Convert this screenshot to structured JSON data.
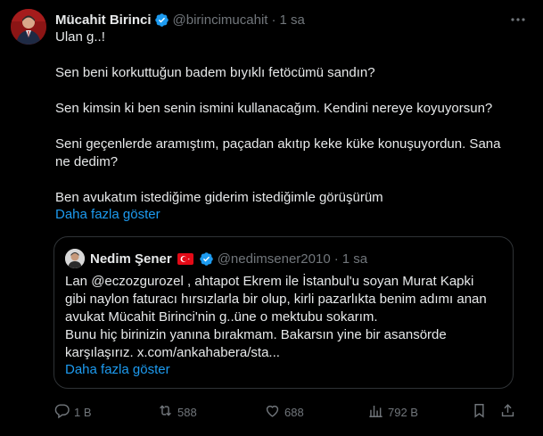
{
  "author": {
    "name": "Mücahit Birinci",
    "handle": "@birincimucahit",
    "separator": "·",
    "time": "1 sa"
  },
  "tweet": {
    "lines": [
      "Ulan g..!",
      "Sen beni korkuttuğun badem bıyıklı fetöcümü sandın?",
      "Sen kimsin ki ben senin ismini kullanacağım. Kendini nereye koyuyorsun?",
      "Seni geçenlerde aramıştım, paçadan akıtıp keke küke konuşuyordun. Sana",
      "ne dedim?",
      "Ben avukatım istediğime giderim istediğimle görüşürüm"
    ],
    "show_more": "Daha fazla göster"
  },
  "quoted": {
    "name": "Nedim Şener",
    "handle": "@nedimsener2010",
    "separator": "·",
    "time": "1 sa",
    "lines": [
      "Lan @eczozgurozel , ahtapot Ekrem ile İstanbul'u soyan Murat Kapki",
      "gibi naylon faturacı hırsızlarla bir olup, kirli pazarlıkta benim adımı anan",
      "avukat Mücahit Birinci'nin g..üne o mektubu sokarım.",
      "Bunu hiç birinizin yanına bırakmam. Bakarsın yine bir asansörde",
      "karşılaşırız. x.com/ankahabera/sta..."
    ],
    "show_more": "Daha fazla göster"
  },
  "actions": {
    "replies": "1 B",
    "reposts": "588",
    "likes": "688",
    "views": "792 B"
  },
  "icons": {
    "verified": "verified-badge-icon",
    "more": "more-dots-icon",
    "flag": "turkey-flag-icon",
    "reply": "reply-icon",
    "repost": "repost-icon",
    "like": "heart-icon",
    "views": "views-chart-icon",
    "bookmark": "bookmark-icon",
    "share": "share-icon"
  },
  "colors": {
    "background": "#000000",
    "text": "#e7e9ea",
    "secondary": "#71767b",
    "link": "#1d9bf0",
    "border": "#2f3336",
    "verified": "#1d9bf0"
  }
}
